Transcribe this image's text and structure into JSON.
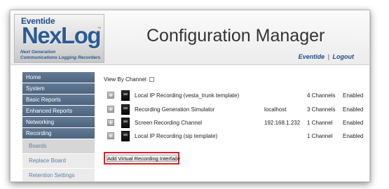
{
  "header": {
    "logo": {
      "brand": "Eventide",
      "product": "NexLog",
      "trademark": "™",
      "tagline_line1": "Next Generation",
      "tagline_line2": "Communications Logging Recorders"
    },
    "title": "Configuration Manager",
    "user_link": "Eventide",
    "separator": "|",
    "logout_link": "Logout"
  },
  "sidebar": {
    "items": [
      {
        "label": "Home"
      },
      {
        "label": "System"
      },
      {
        "label": "Basic Reports"
      },
      {
        "label": "Enhanced Reports"
      },
      {
        "label": "Networking"
      },
      {
        "label": "Recording"
      }
    ],
    "subitems": [
      {
        "label": "Boards",
        "active": true
      },
      {
        "label": "Replace Board",
        "active": false
      },
      {
        "label": "Retention Settings",
        "active": false
      }
    ]
  },
  "main": {
    "view_by_channel_label": "View By Channel",
    "view_by_channel_checked": false,
    "boards": [
      {
        "name": "Local IP Recording (vesta_trunk template)",
        "host": "",
        "channels": "4 Channels",
        "status": "Enabled"
      },
      {
        "name": "Recording Generation Simulator",
        "host": "localhost",
        "channels": "3 Channels",
        "status": "Enabled"
      },
      {
        "name": "Screen Recording Channel",
        "host": "192.168.1.232",
        "channels": "1 Channel",
        "status": "Enabled"
      },
      {
        "name": "Local IP Recording (sip template)",
        "host": "",
        "channels": "1 Channel",
        "status": "Enabled"
      }
    ],
    "expand_glyph": "+",
    "add_button_label": "Add Virtual Recording Interface"
  },
  "colors": {
    "nav_bg": "#5a7190",
    "sub_text": "#5d7fa8",
    "brand_blue": "#2a5b95",
    "highlight_red": "#d8232a"
  }
}
